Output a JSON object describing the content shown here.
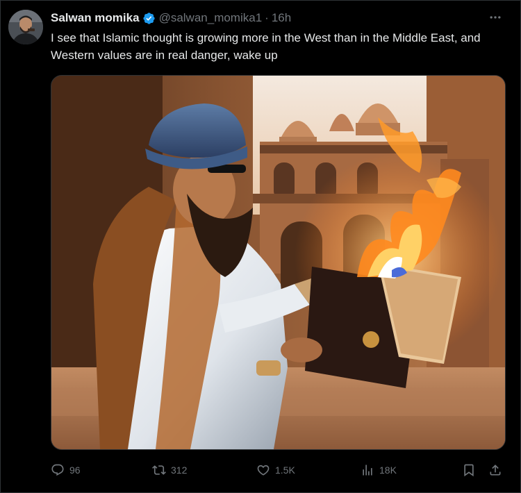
{
  "tweet": {
    "author_name": "Salwan momika",
    "handle": "@salwan_momika1",
    "separator": "·",
    "time": "16h",
    "text": "I see that Islamic thought is growing more in the West than in the Middle East, and Western values are in real danger, wake up",
    "verified": true,
    "verified_color": "#1d9bf0"
  },
  "media": {
    "icon": "ai-image-man-burning-book"
  },
  "actions": {
    "replies": "96",
    "retweets": "312",
    "likes": "1.5K",
    "views": "18K"
  },
  "icons": {
    "reply": "comment-bubble-icon",
    "retweet": "retweet-icon",
    "like": "heart-icon",
    "views": "bar-chart-icon",
    "bookmark": "bookmark-icon",
    "share": "share-icon",
    "more": "ellipsis-icon"
  },
  "colors": {
    "background": "#000000",
    "text": "#e7e9ea",
    "muted": "#71767b",
    "border": "#2f3336"
  }
}
